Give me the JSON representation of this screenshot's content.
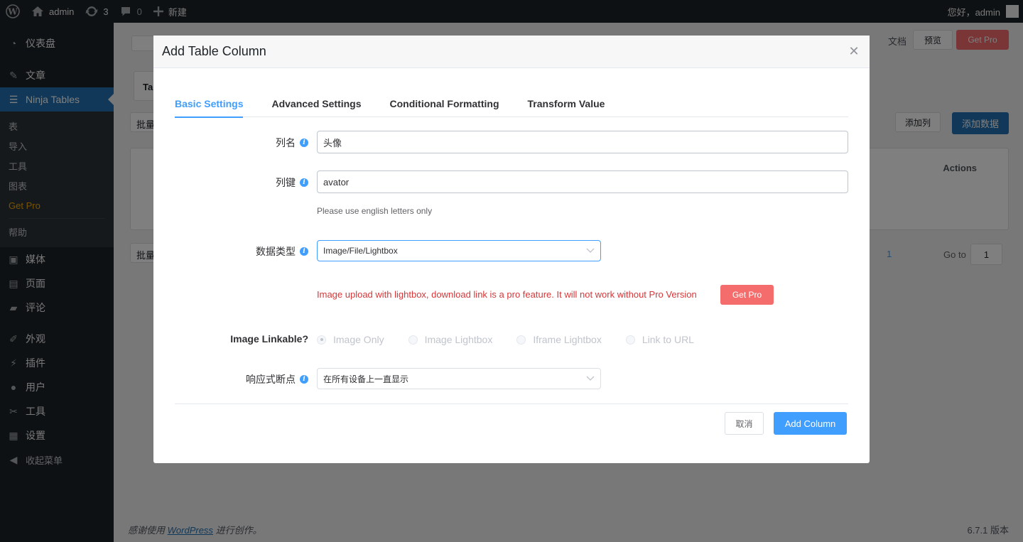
{
  "adminbar": {
    "site_name": "admin",
    "updates_count": "3",
    "comments_count": "0",
    "new_label": "新建",
    "greeting": "您好，admin"
  },
  "sidebar": {
    "items": [
      {
        "label": "仪表盘",
        "icon": "dashboard-icon"
      },
      {
        "label": "文章",
        "icon": "pin-icon"
      },
      {
        "label": "Ninja Tables",
        "icon": "table-icon"
      },
      {
        "label": "媒体",
        "icon": "media-icon"
      },
      {
        "label": "页面",
        "icon": "page-icon"
      },
      {
        "label": "评论",
        "icon": "comment-icon"
      },
      {
        "label": "外观",
        "icon": "brush-icon"
      },
      {
        "label": "插件",
        "icon": "plugin-icon"
      },
      {
        "label": "用户",
        "icon": "user-icon"
      },
      {
        "label": "工具",
        "icon": "wrench-icon"
      },
      {
        "label": "设置",
        "icon": "settings-icon"
      },
      {
        "label": "收起菜单",
        "icon": "collapse-icon"
      }
    ],
    "submenu": [
      "表",
      "导入",
      "工具",
      "图表",
      "Get Pro",
      "帮助"
    ]
  },
  "background": {
    "docs_label": "文档",
    "preview_label": "预览",
    "get_pro_label": "Get Pro",
    "tab_prefix": "Ta",
    "bulk_label": "批量",
    "add_column_label": "添加列",
    "add_data_label": "添加数据",
    "actions_header": "Actions",
    "page_number": "1",
    "goto_label": "Go to",
    "goto_value": "1"
  },
  "footer": {
    "thanks_prefix": "感谢使用",
    "wp_link": "WordPress",
    "thanks_suffix": "进行创作。",
    "version": "6.7.1 版本"
  },
  "modal": {
    "title": "Add Table Column",
    "tabs": [
      "Basic Settings",
      "Advanced Settings",
      "Conditional Formatting",
      "Transform Value"
    ],
    "column_name_label": "列名",
    "column_name_value": "头像",
    "column_key_label": "列键",
    "column_key_value": "avator",
    "column_key_help": "Please use english letters only",
    "data_type_label": "数据类型",
    "data_type_value": "Image/File/Lightbox",
    "pro_message": "Image upload with lightbox, download link is a pro feature. It will not work without Pro Version",
    "pro_button": "Get Pro",
    "linkable_label": "Image Linkable?",
    "linkable_options": [
      "Image Only",
      "Image Lightbox",
      "Iframe Lightbox",
      "Link to URL"
    ],
    "linkable_selected": "Image Only",
    "breakpoint_label": "响应式断点",
    "breakpoint_value": "在所有设备上一直显示",
    "cancel_button": "取消",
    "add_button": "Add Column"
  },
  "colors": {
    "accent": "#409eff",
    "wp_blue": "#2271b1",
    "danger": "#d63638",
    "pro_button": "#f56c6c",
    "admin_bg": "#1d2327"
  }
}
